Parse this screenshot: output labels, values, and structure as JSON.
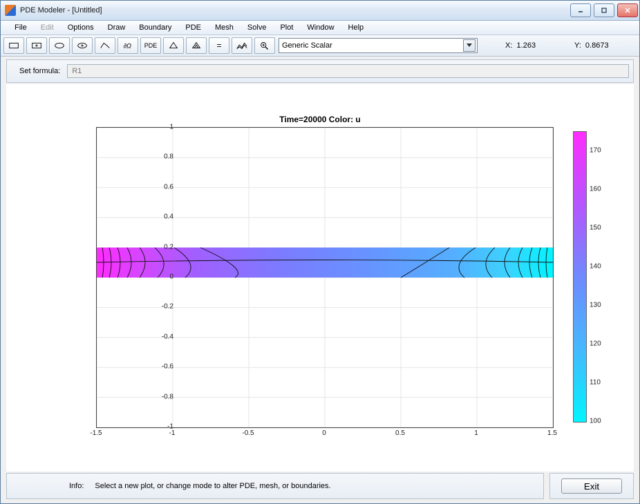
{
  "window": {
    "title": "PDE Modeler - [Untitled]"
  },
  "menu": {
    "file": "File",
    "edit": "Edit",
    "options": "Options",
    "draw": "Draw",
    "boundary": "Boundary",
    "pde": "PDE",
    "mesh": "Mesh",
    "solve": "Solve",
    "plot": "Plot",
    "window": "Window",
    "help": "Help"
  },
  "toolbar": {
    "btn_rect": "rectangle-icon",
    "btn_rect_center": "rectangle-center-icon",
    "btn_ellipse": "ellipse-icon",
    "btn_ellipse_center": "ellipse-center-icon",
    "btn_polygon": "polygon-icon",
    "btn_boundary": "boundary-icon",
    "btn_pde": "PDE",
    "btn_mesh": "mesh-icon",
    "btn_refine": "refine-mesh-icon",
    "btn_solve": "=",
    "btn_plot": "plot3d-icon",
    "btn_zoom": "zoom-icon",
    "type_select": "Generic Scalar"
  },
  "coords": {
    "x_label": "X:",
    "x_val": "1.263",
    "y_label": "Y:",
    "y_val": "0.8673"
  },
  "formula": {
    "label": "Set formula:",
    "value": "R1"
  },
  "info": {
    "label": "Info:",
    "text": "Select a new plot, or change mode to alter PDE, mesh, or boundaries."
  },
  "exit": {
    "label": "Exit"
  },
  "chart_data": {
    "type": "heatmap",
    "title": "Time=20000   Color: u",
    "xlabel": "",
    "ylabel": "",
    "xlim": [
      -1.5,
      1.5
    ],
    "ylim": [
      -1,
      1
    ],
    "region_y": [
      0,
      0.2
    ],
    "x_ticks": [
      -1.5,
      -1,
      -0.5,
      0,
      0.5,
      1,
      1.5
    ],
    "y_ticks": [
      -1,
      -0.8,
      -0.6,
      -0.4,
      -0.2,
      0,
      0.2,
      0.4,
      0.6,
      0.8,
      1
    ],
    "colorbar": {
      "min": 100,
      "max": 175,
      "ticks": [
        100,
        110,
        120,
        130,
        140,
        150,
        160,
        170
      ]
    },
    "field_samples_u_along_x": [
      {
        "x": -1.5,
        "u": 173
      },
      {
        "x": -1.3,
        "u": 160
      },
      {
        "x": -1.1,
        "u": 150
      },
      {
        "x": -0.9,
        "u": 142
      },
      {
        "x": -0.5,
        "u": 136
      },
      {
        "x": 0.0,
        "u": 134
      },
      {
        "x": 0.5,
        "u": 133
      },
      {
        "x": 0.9,
        "u": 130
      },
      {
        "x": 1.1,
        "u": 124
      },
      {
        "x": 1.3,
        "u": 112
      },
      {
        "x": 1.5,
        "u": 100
      }
    ]
  }
}
